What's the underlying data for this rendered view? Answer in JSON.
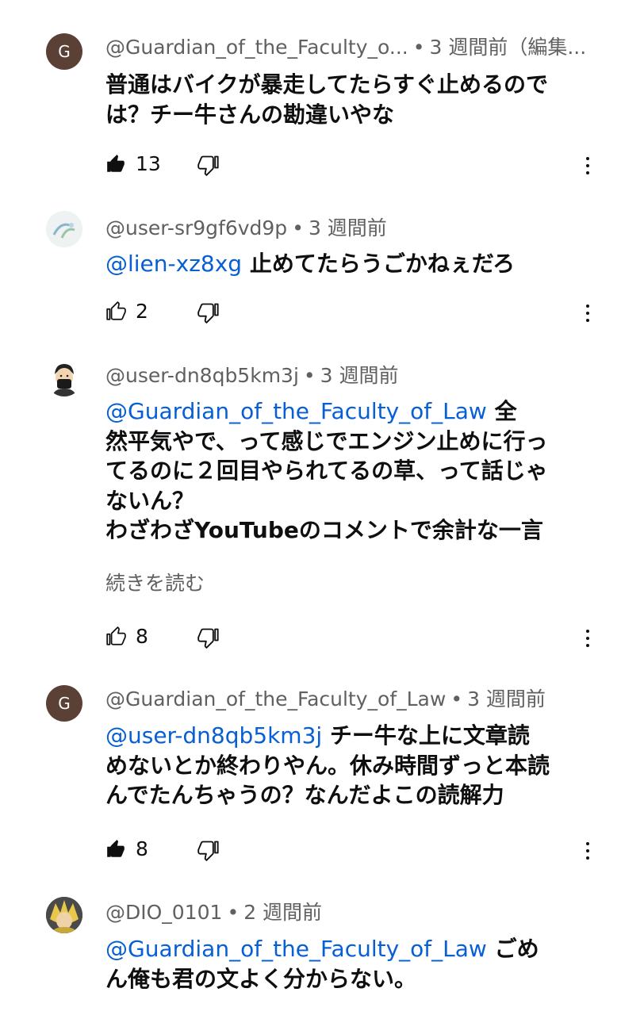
{
  "comments": [
    {
      "avatar_letter": "G",
      "author": "@Guardian_of_the_Faculty_o...",
      "time": "3 週間前（編集...",
      "line1": "普通はバイクが暴走してたらすぐ止めるので",
      "line2": "は？チー牛さんの勘違いやな",
      "likes": "13"
    },
    {
      "author": "@user-sr9gf6vd9p",
      "time": "3 週間前",
      "mention": "@lien-xz8xg",
      "text": "止めてたらうごかねぇだろ",
      "likes": "2"
    },
    {
      "author": "@user-dn8qb5km3j",
      "time": "3 週間前",
      "mention": "@Guardian_of_the_Faculty_of_Law",
      "line1_tail": " 全",
      "line2": "然平気やで、って感じでエンジン止めに行っ",
      "line3": "てるのに２回目やられてるの草、って話じゃ",
      "line4": "ないん？",
      "line5": "わざわざYouTubeのコメントで余計な一言",
      "read_more": "続きを読む",
      "likes": "8"
    },
    {
      "avatar_letter": "G",
      "author": "@Guardian_of_the_Faculty_of_Law",
      "time": "3 週間前",
      "mention": "@user-dn8qb5km3j",
      "line1_tail": " チー牛な上に文章読",
      "line2": "めないとか終わりやん。休み時間ずっと本読",
      "line3": "んでたんちゃうの？なんだよこの読解力",
      "likes": "8"
    },
    {
      "author": "@DIO_0101",
      "time": "2 週間前",
      "mention": "@Guardian_of_the_Faculty_of_Law",
      "line1_tail": " ごめ",
      "line2": "ん俺も君の文よく分からない。"
    }
  ],
  "separator": "•"
}
